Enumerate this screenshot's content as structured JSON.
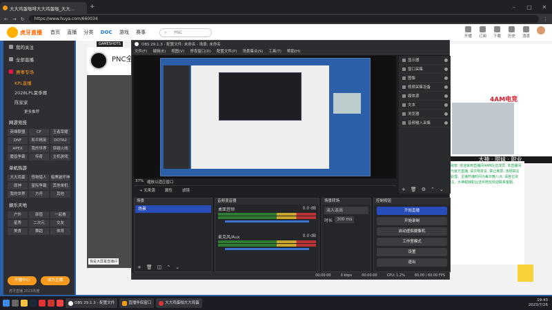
{
  "browser": {
    "tab1_title": "大大鸡蛋咖啡大大鸡蛋咖_大大...",
    "new_tab": "+",
    "url": "https://www.huya.com/660034"
  },
  "site": {
    "logo_text": "虎牙直播",
    "nav": [
      "首页",
      "直播",
      "分类",
      "游戏",
      "赛事"
    ],
    "brand_badge": "DOC",
    "search_placeholder": "PNC",
    "header_icons": [
      "开播",
      "订阅",
      "下载",
      "历史",
      "消息"
    ]
  },
  "sidebar": {
    "top_items": [
      "我的关注",
      "全部直播",
      "赛事专场"
    ],
    "sub_items": [
      "KPL直播",
      "2028LPL夏季赛",
      "陈家家"
    ],
    "sub_more": "更多推荐",
    "section_game": "网游竞技",
    "game_tags": [
      "英雄联盟",
      "CF",
      "王者荣耀",
      "DNF",
      "和平精英",
      "DOTA2",
      "APEX",
      "我的世界",
      "穿越火线",
      "魔兽争霸",
      "传奇",
      "主机游戏"
    ],
    "section_mobile": "单机热游",
    "mobile_tags": [
      "大大鸡蛋",
      "怪物猎人",
      "暗黑破坏神",
      "原神",
      "星际争霸",
      "其他单机",
      "我的世界",
      "方舟",
      "其他"
    ],
    "section_ent": "娱乐天地",
    "ent_tags": [
      "户外",
      "颜值",
      "一起看",
      "星秀",
      "二次元",
      "交友",
      "美食",
      "舞蹈",
      "体育"
    ],
    "btn_left": "开播中心",
    "btn_right": "成为主播",
    "copyright": "虎牙直播 2023年度"
  },
  "stream": {
    "badge": "GAMESHOTS",
    "streamer_name": "PNC全",
    "subtitle_text": "我是大屏幕直播间"
  },
  "ad": {
    "title": "4AM电竞",
    "line": "大神 · 甜妹 · 职业"
  },
  "chat": {
    "text": "房管: 欢迎来到直播间4AM队伍成员, 本直播间为官方直播, 请文明发言, 禁止刷屏, 违规禁言处理。主播开播时间为每日晚八点, 请各位关注。大神甜妹职业选手陪玩欢迎联系客服。"
  },
  "obs": {
    "title": "OBS 29.1.3 - 配置文件: 未命名 - 场景: 未命名",
    "menu": [
      "文件(F)",
      "编辑(E)",
      "视图(V)",
      "停靠窗口(D)",
      "配置文件(P)",
      "场景集合(S)",
      "工具(T)",
      "帮助(H)"
    ],
    "sources": [
      "显示器",
      "窗口采集",
      "图像",
      "视频采集设备",
      "媒体源",
      "文本",
      "浏览器",
      "音频输入采集"
    ],
    "toolbar": [
      "+ 无来源",
      "属性",
      "滤镜"
    ],
    "zoom": "37%",
    "zoom_label": "缩放以适应窗口",
    "dock_scenes": "场景",
    "scene_name": "场景",
    "dock_mixer": "音频混音器",
    "mixer_tracks": [
      {
        "name": "桌面音频",
        "db": "0.0 dB"
      },
      {
        "name": "麦克风/Aux",
        "db": "0.0 dB"
      }
    ],
    "dock_transitions": "场景转场",
    "transition_type": "淡入淡出",
    "duration_label": "时长",
    "duration_value": "300 ms",
    "dock_controls": "控制按钮",
    "controls": [
      "开始直播",
      "开始录制",
      "启动虚拟摄像机",
      "工作室模式",
      "设置",
      "退出"
    ],
    "status": [
      "00:00:00",
      "0 kbps",
      "00:00:00",
      "CPU: 1.2%",
      "60.00 / 60.00 FPS"
    ]
  },
  "taskbar": {
    "apps": [
      "OBS 29.1.3 - 配置文件",
      "直播伴侣窗口",
      "大大鸡蛋咖大大鸡蛋"
    ],
    "time": "19:43",
    "date": "2023/7/26"
  },
  "colors": {
    "accent": "#f79a1e",
    "obs_blue": "#284cb8",
    "desk_blue": "#2b5fa8"
  }
}
